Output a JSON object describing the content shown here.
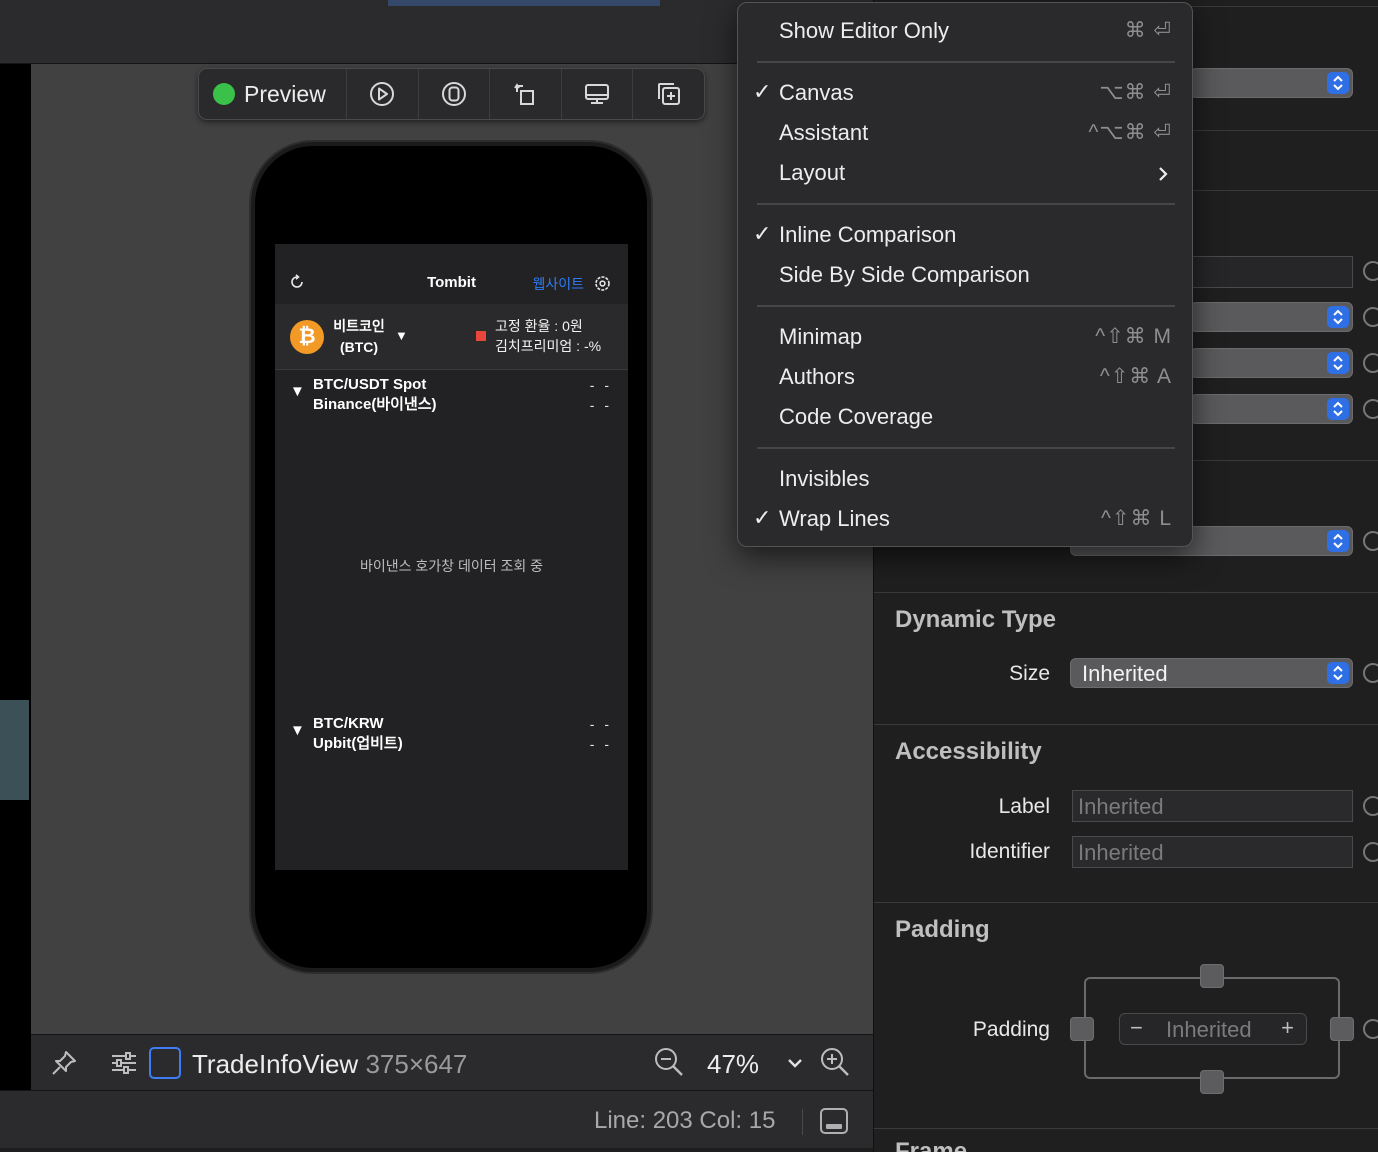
{
  "preview_toolbar": {
    "preview_label": "Preview",
    "status_color": "#3ac14a",
    "buttons": [
      "play-icon",
      "live-icon",
      "rotate-icon",
      "device-icon",
      "duplicate-icon"
    ]
  },
  "phone_app": {
    "title": "Tombit",
    "website_link": "웹사이트",
    "coin_name": "비트코인",
    "coin_symbol": "(BTC)",
    "coin_logo": "₿",
    "caret": "▼",
    "fixed_rate": "고정 환율 : 0원",
    "kimchi_premium": "김치프리미엄 : -%",
    "markets": [
      {
        "caret": "▼",
        "pair": "BTC/USDT Spot",
        "exchange": "Binance(바이낸스)",
        "value1": "- -",
        "value2": "- -"
      },
      {
        "caret": "▼",
        "pair": "BTC/KRW",
        "exchange": "Upbit(업비트)",
        "value1": "- -",
        "value2": "- -"
      }
    ],
    "loading_text": "바이낸스 호가창 데이터 조회 중"
  },
  "canvas_bottom": {
    "view_name": "TradeInfoView",
    "view_size": "375×647",
    "zoom": "47%"
  },
  "status": {
    "position": "Line: 203  Col: 15"
  },
  "inspector": {
    "dynamic_type": {
      "heading": "Dynamic Type",
      "size_label": "Size",
      "size_value": "Inherited"
    },
    "accessibility": {
      "heading": "Accessibility",
      "label_label": "Label",
      "label_placeholder": "Inherited",
      "identifier_label": "Identifier",
      "identifier_placeholder": "Inherited"
    },
    "padding": {
      "heading": "Padding",
      "padding_label": "Padding",
      "padding_value": "Inherited",
      "minus": "−",
      "plus": "+"
    },
    "frame_heading": "Frame"
  },
  "editor_menu": {
    "items": [
      {
        "label": "Show Editor Only",
        "checked": false,
        "shortcut": "⌘ ⏎",
        "check": ""
      },
      {
        "label": "Canvas",
        "checked": true,
        "shortcut": "⌥⌘ ⏎",
        "check": "✓"
      },
      {
        "label": "Assistant",
        "checked": false,
        "shortcut": "^⌥⌘ ⏎",
        "check": ""
      },
      {
        "label": "Layout",
        "checked": false,
        "shortcut": "",
        "check": "",
        "submenu": true
      },
      {
        "label": "Inline Comparison",
        "checked": true,
        "shortcut": "",
        "check": "✓"
      },
      {
        "label": "Side By Side Comparison",
        "checked": false,
        "shortcut": "",
        "check": ""
      },
      {
        "label": "Minimap",
        "checked": false,
        "shortcut": "^⇧⌘ M",
        "check": ""
      },
      {
        "label": "Authors",
        "checked": false,
        "shortcut": "^⇧⌘ A",
        "check": ""
      },
      {
        "label": "Code Coverage",
        "checked": false,
        "shortcut": "",
        "check": ""
      },
      {
        "label": "Invisibles",
        "checked": false,
        "shortcut": "",
        "check": ""
      },
      {
        "label": "Wrap Lines",
        "checked": true,
        "shortcut": "^⇧⌘ L",
        "check": "✓"
      }
    ]
  }
}
